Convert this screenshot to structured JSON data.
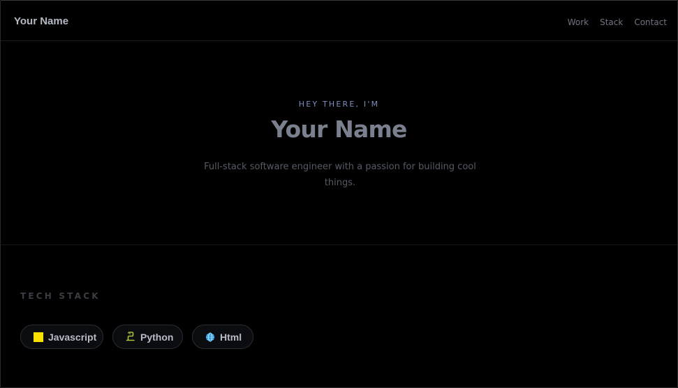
{
  "header": {
    "brand": "Your Name",
    "nav": [
      {
        "label": "Work"
      },
      {
        "label": "Stack"
      },
      {
        "label": "Contact"
      }
    ]
  },
  "hero": {
    "eyebrow": "HEY THERE, I'M",
    "title": "Your Name",
    "tagline": "Full-stack software engineer with a passion for building cool things."
  },
  "stack": {
    "heading": "TECH STACK",
    "items": [
      {
        "label": "Javascript",
        "icon": "javascript-icon",
        "color": "#f7e000"
      },
      {
        "label": "Python",
        "icon": "python-icon",
        "color": "#a4c639"
      },
      {
        "label": "Html",
        "icon": "globe-icon",
        "color": "#3aa8e0"
      }
    ]
  }
}
